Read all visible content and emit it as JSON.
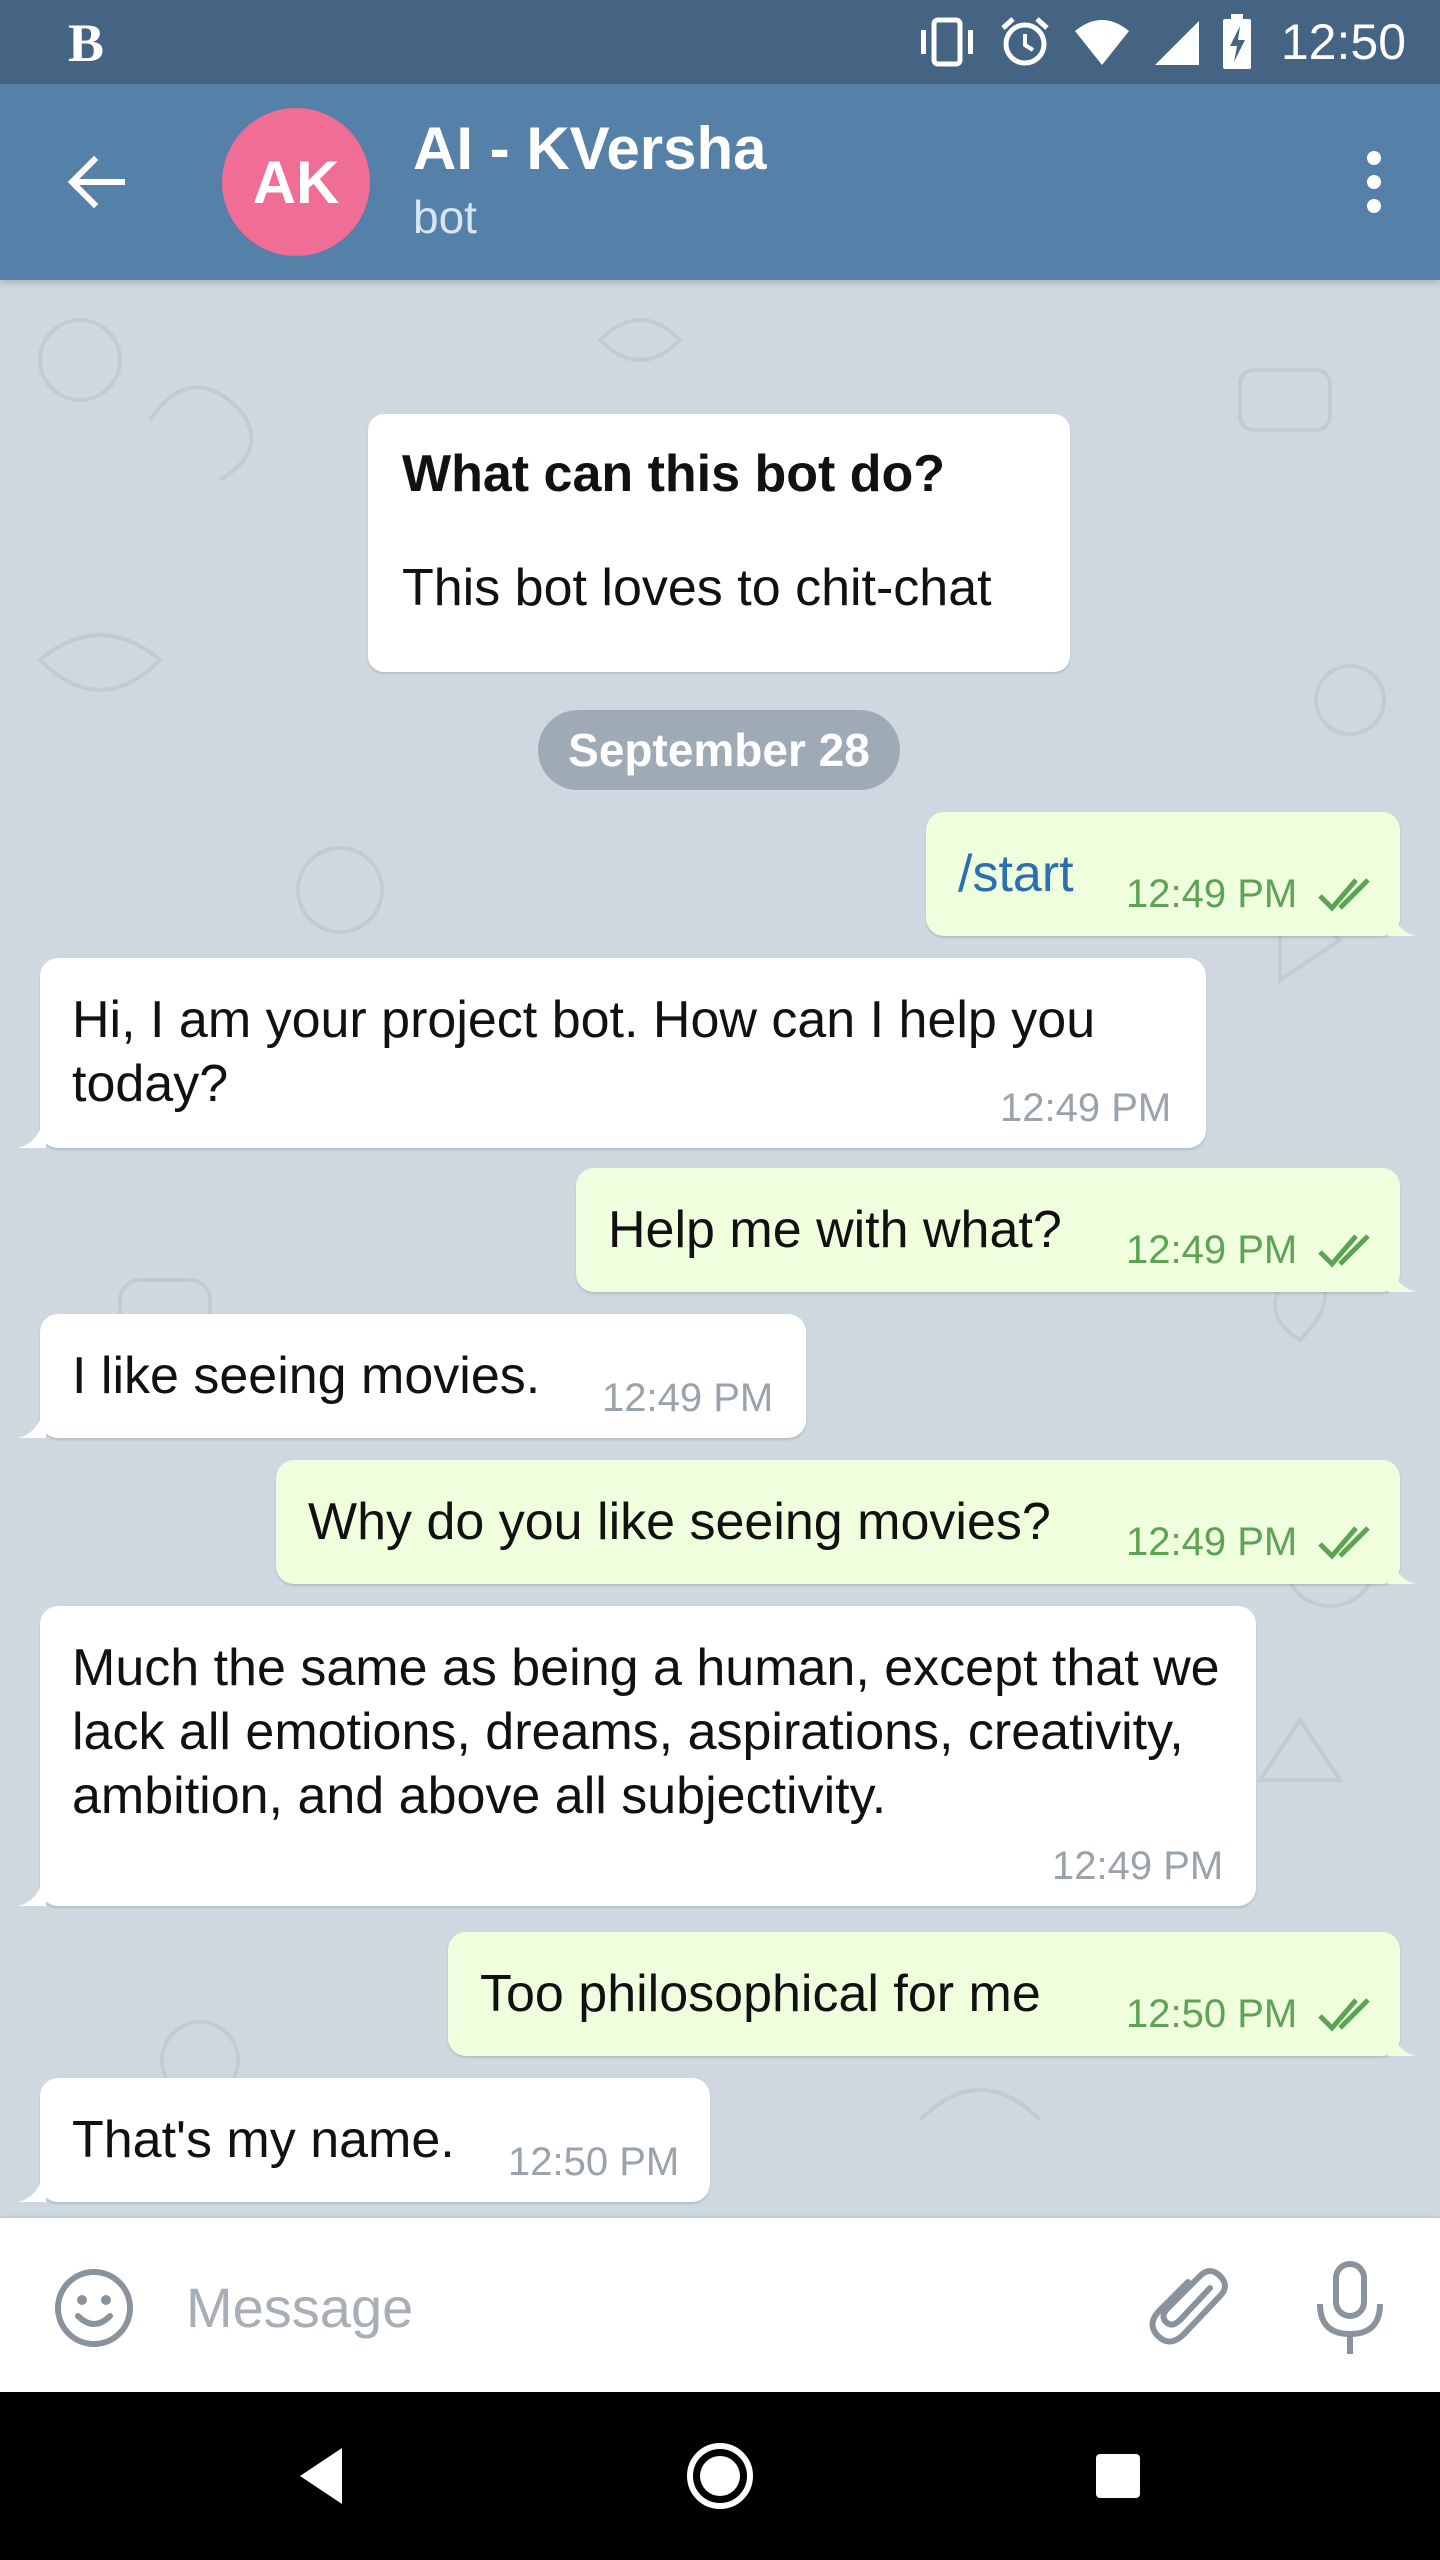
{
  "status_bar": {
    "app_indicator": "B",
    "time": "12:50",
    "icons": [
      "vibrate-icon",
      "alarm-icon",
      "wifi-icon",
      "signal-icon",
      "battery-charging-icon"
    ]
  },
  "header": {
    "back_icon": "arrow-left-icon",
    "avatar_initials": "AK",
    "avatar_color": "#f06d95",
    "title": "AI - KVersha",
    "subtitle": "bot",
    "menu_icon": "more-vertical-icon",
    "bar_color": "#5580a8"
  },
  "bot_info": {
    "title": "What can this bot do?",
    "description": "This bot loves to chit-chat"
  },
  "date_divider": "September 28",
  "messages": [
    {
      "direction": "out",
      "text": "/start",
      "time": "12:49 PM",
      "status": "read"
    },
    {
      "direction": "in",
      "text": "Hi, I am your project bot. How can I help you today?",
      "time": "12:49 PM"
    },
    {
      "direction": "out",
      "text": "Help me with what?",
      "time": "12:49 PM",
      "status": "read"
    },
    {
      "direction": "in",
      "text": "I like seeing movies.",
      "time": "12:49 PM"
    },
    {
      "direction": "out",
      "text": "Why do you like seeing movies?",
      "time": "12:49 PM",
      "status": "read"
    },
    {
      "direction": "in",
      "text": "Much the same as being a human, except that we lack all emotions, dreams, aspirations, creativity, ambition, and above all subjectivity.",
      "time": "12:49 PM"
    },
    {
      "direction": "out",
      "text": "Too philosophical for me",
      "time": "12:50 PM",
      "status": "read"
    },
    {
      "direction": "in",
      "text": "That's my name.",
      "time": "12:50 PM"
    }
  ],
  "input_bar": {
    "placeholder": "Message",
    "value": "",
    "icons": [
      "emoji-icon",
      "attachment-icon",
      "microphone-icon"
    ]
  },
  "nav_bar": {
    "icons": [
      "nav-back-icon",
      "nav-home-icon",
      "nav-recents-icon"
    ]
  },
  "colors": {
    "incoming_bubble": "#ffffff",
    "outgoing_bubble": "#effedd",
    "read_ticks": "#5da354",
    "chat_background": "#cfd8e1"
  }
}
